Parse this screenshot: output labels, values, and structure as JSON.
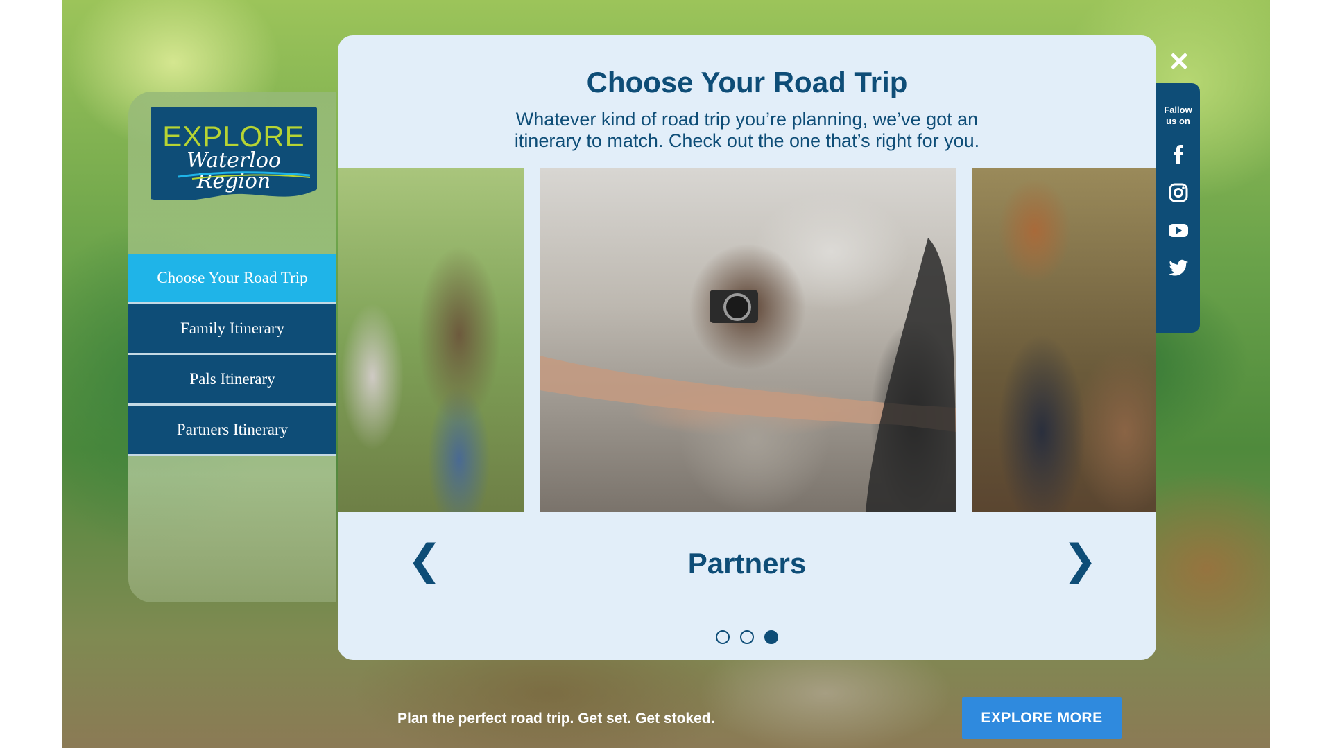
{
  "logo": {
    "line1": "EXPLORE",
    "line2": "Waterloo Region"
  },
  "menu": {
    "items": [
      {
        "label": "Choose Your Road Trip",
        "active": true
      },
      {
        "label": "Family Itinerary",
        "active": false
      },
      {
        "label": "Pals Itinerary",
        "active": false
      },
      {
        "label": "Partners Itinerary",
        "active": false
      }
    ]
  },
  "modal": {
    "title": "Choose Your Road Trip",
    "subtitle": "Whatever kind of road trip you’re planning, we’ve got an itinerary to match. Check out the one that’s right for you.",
    "slide_label": "Partners",
    "prev_icon": "chevron-left-icon",
    "next_icon": "chevron-right-icon",
    "slide_count": 3,
    "current_slide": 3
  },
  "social": {
    "follow_label_line1": "Fallow",
    "follow_label_line2": "us on",
    "icons": [
      "facebook-icon",
      "instagram-icon",
      "youtube-icon",
      "twitter-icon"
    ]
  },
  "footer": {
    "tagline": "Plan the perfect road trip. Get set. Get stoked.",
    "button_label": "EXPLORE MORE"
  },
  "colors": {
    "navy": "#0e4d77",
    "active_menu": "#1fb4e8",
    "modal_bg": "#e2eef9",
    "button_blue": "#2f8ade",
    "logo_green": "#b7d433"
  }
}
